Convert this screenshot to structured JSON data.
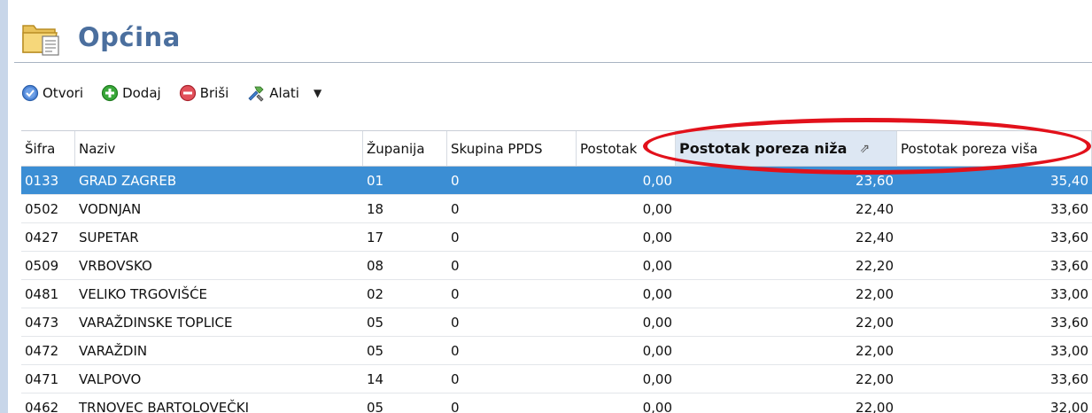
{
  "window": {
    "title": "Općina",
    "title_icon": "folder-document-icon"
  },
  "toolbar": {
    "open_label": "Otvori",
    "add_label": "Dodaj",
    "delete_label": "Briši",
    "tools_label": "Alati",
    "open_icon": "check-circle-icon",
    "add_icon": "plus-circle-icon",
    "delete_icon": "minus-circle-icon",
    "tools_icon": "tools-icon",
    "dropdown_glyph": "▼"
  },
  "grid": {
    "columns": [
      "Šifra",
      "Naziv",
      "Županija",
      "Skupina PPDS",
      "Postotak",
      "Postotak poreza niža",
      "Postotak poreza viša"
    ],
    "sorted_column": "Postotak poreza niža",
    "sort_glyph": "⇗",
    "rows": [
      {
        "sifra": "0133",
        "naziv": "GRAD ZAGREB",
        "zupanija": "01",
        "skupina": "0",
        "postotak": "0,00",
        "niza": "23,60",
        "visa": "35,40",
        "selected": true
      },
      {
        "sifra": "0502",
        "naziv": "VODNJAN",
        "zupanija": "18",
        "skupina": "0",
        "postotak": "0,00",
        "niza": "22,40",
        "visa": "33,60"
      },
      {
        "sifra": "0427",
        "naziv": "SUPETAR",
        "zupanija": "17",
        "skupina": "0",
        "postotak": "0,00",
        "niza": "22,40",
        "visa": "33,60"
      },
      {
        "sifra": "0509",
        "naziv": "VRBOVSKO",
        "zupanija": "08",
        "skupina": "0",
        "postotak": "0,00",
        "niza": "22,20",
        "visa": "33,60"
      },
      {
        "sifra": "0481",
        "naziv": "VELIKO TRGOVIŠĆE",
        "zupanija": "02",
        "skupina": "0",
        "postotak": "0,00",
        "niza": "22,00",
        "visa": "33,00"
      },
      {
        "sifra": "0473",
        "naziv": "VARAŽDINSKE TOPLICE",
        "zupanija": "05",
        "skupina": "0",
        "postotak": "0,00",
        "niza": "22,00",
        "visa": "33,60"
      },
      {
        "sifra": "0472",
        "naziv": "VARAŽDIN",
        "zupanija": "05",
        "skupina": "0",
        "postotak": "0,00",
        "niza": "22,00",
        "visa": "33,00"
      },
      {
        "sifra": "0471",
        "naziv": "VALPOVO",
        "zupanija": "14",
        "skupina": "0",
        "postotak": "0,00",
        "niza": "22,00",
        "visa": "33,60"
      },
      {
        "sifra": "0462",
        "naziv": "TRNOVEC BARTOLOVEČKI",
        "zupanija": "05",
        "skupina": "0",
        "postotak": "0,00",
        "niza": "22,00",
        "visa": "32,00"
      }
    ]
  },
  "colors": {
    "title": "#4b6f9e",
    "selection": "#3b8ed4",
    "highlight_ellipse": "#e2111b",
    "sorted_header": "#dde7f3"
  }
}
